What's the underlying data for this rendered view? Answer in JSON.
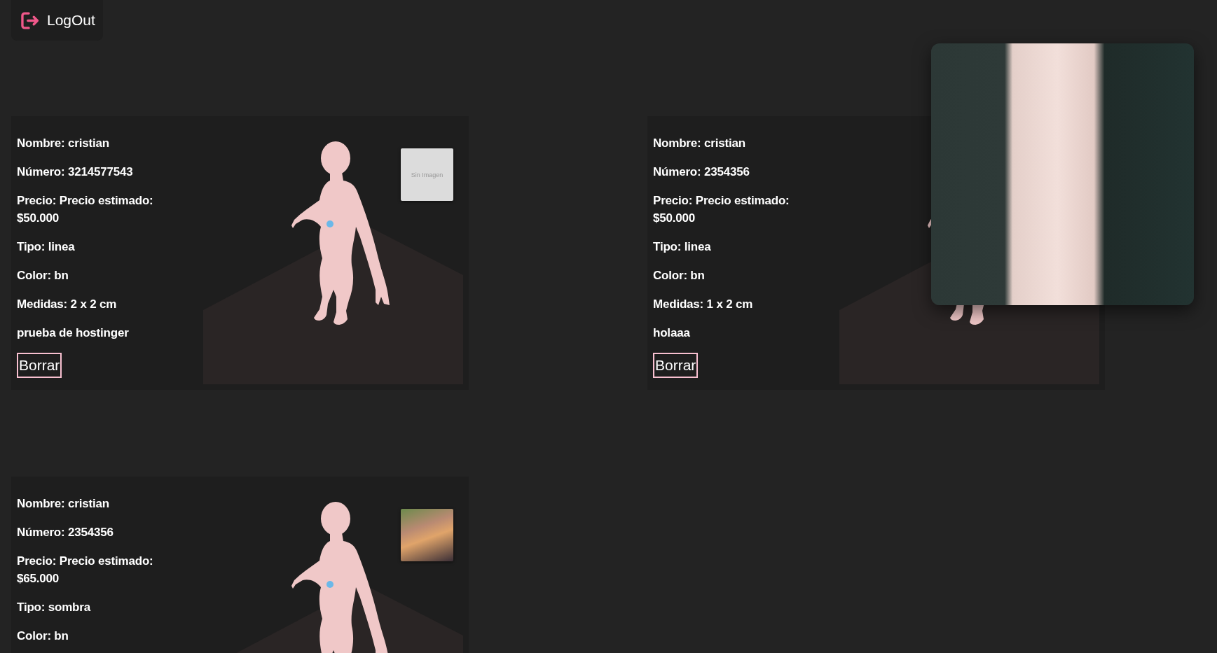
{
  "logout_button": {
    "label": "LogOut"
  },
  "orders": [
    {
      "fields": [
        "Nombre: cristian",
        "Número: 3214577543",
        "Precio: Precio estimado: $50.000",
        "Tipo: linea",
        "Color: bn",
        "Medidas: 2 x 2 cm"
      ],
      "note": "prueba de hostinger",
      "delete_button": {
        "label": "Borrar"
      },
      "reference_image": {
        "kind": "placeholder",
        "text": "Sin Imagen",
        "enlarged": false
      }
    },
    {
      "fields": [
        "Nombre: cristian",
        "Número: 2354356",
        "Precio: Precio estimado: $50.000",
        "Tipo: linea",
        "Color: bn",
        "Medidas: 1 x 2 cm"
      ],
      "note": "holaaa",
      "delete_button": {
        "label": "Borrar"
      },
      "reference_image": {
        "kind": "photo",
        "enlarged": true
      }
    },
    {
      "fields": [
        "Nombre: cristian",
        "Número: 2354356",
        "Precio: Precio estimado: $65.000",
        "Tipo: sombra",
        "Color: bn"
      ],
      "reference_image": {
        "kind": "photo",
        "enlarged": false
      }
    }
  ]
}
